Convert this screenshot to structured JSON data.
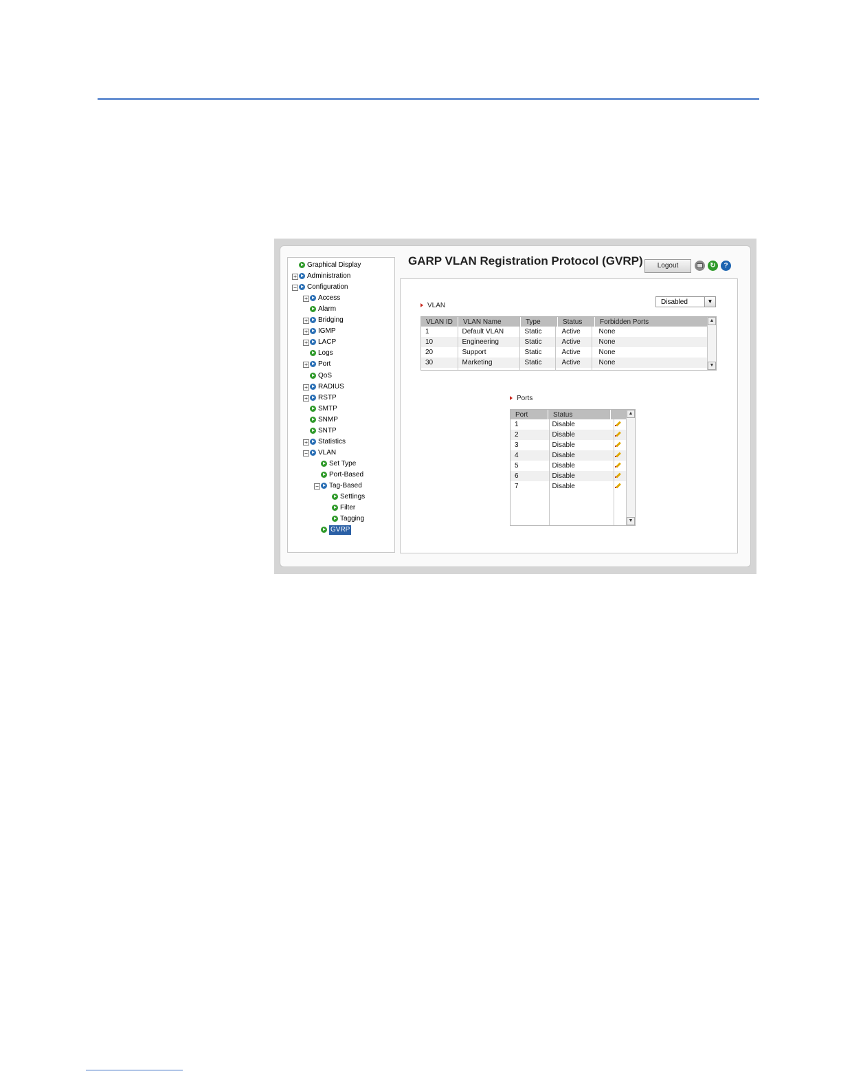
{
  "app": {
    "title": "GARP VLAN Registration Protocol (GVRP)",
    "logout_label": "Logout",
    "colors": {
      "accent": "#2a5fa5",
      "header_bg": "#bdbdbd",
      "rule": "#3a6fc4"
    }
  },
  "toolbar": {
    "icons": [
      "printer-icon",
      "refresh-icon",
      "help-icon"
    ],
    "help_glyph": "?",
    "refresh_glyph": "↻"
  },
  "nav": {
    "items": [
      {
        "label": "Graphical Display",
        "expander": "",
        "bullet": "green"
      },
      {
        "label": "Administration",
        "expander": "+",
        "bullet": "blue"
      },
      {
        "label": "Configuration",
        "expander": "−",
        "bullet": "blue"
      },
      {
        "label": "Access",
        "expander": "+",
        "bullet": "blue"
      },
      {
        "label": "Alarm",
        "expander": "",
        "bullet": "green"
      },
      {
        "label": "Bridging",
        "expander": "+",
        "bullet": "blue"
      },
      {
        "label": "IGMP",
        "expander": "+",
        "bullet": "blue"
      },
      {
        "label": "LACP",
        "expander": "+",
        "bullet": "blue"
      },
      {
        "label": "Logs",
        "expander": "",
        "bullet": "green"
      },
      {
        "label": "Port",
        "expander": "+",
        "bullet": "blue"
      },
      {
        "label": "QoS",
        "expander": "",
        "bullet": "green"
      },
      {
        "label": "RADIUS",
        "expander": "+",
        "bullet": "blue"
      },
      {
        "label": "RSTP",
        "expander": "+",
        "bullet": "blue"
      },
      {
        "label": "SMTP",
        "expander": "",
        "bullet": "green"
      },
      {
        "label": "SNMP",
        "expander": "",
        "bullet": "green"
      },
      {
        "label": "SNTP",
        "expander": "",
        "bullet": "green"
      },
      {
        "label": "Statistics",
        "expander": "+",
        "bullet": "blue"
      },
      {
        "label": "VLAN",
        "expander": "−",
        "bullet": "blue"
      },
      {
        "label": "Set Type",
        "expander": "",
        "bullet": "green"
      },
      {
        "label": "Port-Based",
        "expander": "",
        "bullet": "green"
      },
      {
        "label": "Tag-Based",
        "expander": "−",
        "bullet": "blue"
      },
      {
        "label": "Settings",
        "expander": "",
        "bullet": "green"
      },
      {
        "label": "Filter",
        "expander": "",
        "bullet": "green"
      },
      {
        "label": "Tagging",
        "expander": "",
        "bullet": "green"
      },
      {
        "label": "GVRP",
        "expander": "",
        "bullet": "green",
        "selected": true
      }
    ]
  },
  "vlan": {
    "label": "VLAN",
    "gvrp_select": {
      "value": "Disabled",
      "arrow": "▼"
    },
    "headers": [
      "VLAN ID",
      "VLAN Name",
      "Type",
      "Status",
      "Forbidden Ports"
    ],
    "rows": [
      [
        "1",
        "Default VLAN",
        "Static",
        "Active",
        "None"
      ],
      [
        "10",
        "Engineering",
        "Static",
        "Active",
        "None"
      ],
      [
        "20",
        "Support",
        "Static",
        "Active",
        "None"
      ],
      [
        "30",
        "Marketing",
        "Static",
        "Active",
        "None"
      ]
    ]
  },
  "ports": {
    "label": "Ports",
    "headers": [
      "Port",
      "Status"
    ],
    "rows": [
      [
        "1",
        "Disable"
      ],
      [
        "2",
        "Disable"
      ],
      [
        "3",
        "Disable"
      ],
      [
        "4",
        "Disable"
      ],
      [
        "5",
        "Disable"
      ],
      [
        "6",
        "Disable"
      ],
      [
        "7",
        "Disable"
      ]
    ]
  },
  "scroll": {
    "up": "▲",
    "down": "▼"
  }
}
